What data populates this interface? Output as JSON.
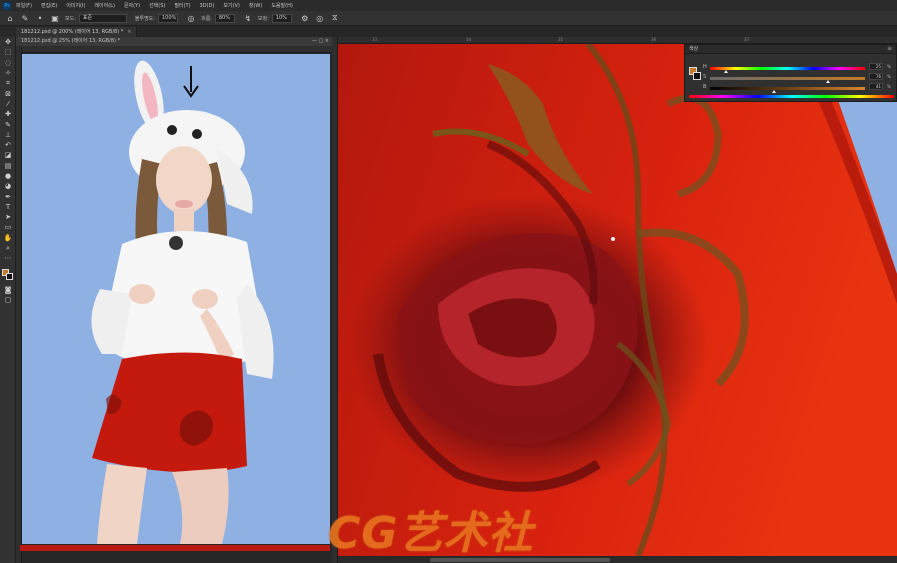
{
  "menu": {
    "app_icon": "Ps",
    "items": [
      "파일(F)",
      "편집(E)",
      "이미지(I)",
      "레이어(L)",
      "문자(Y)",
      "선택(S)",
      "필터(T)",
      "3D(D)",
      "보기(V)",
      "창(W)",
      "도움말(H)"
    ]
  },
  "options": {
    "mode_label": "모드:",
    "mode_value": "표준",
    "opacity_label": "불투명도:",
    "opacity_value": "100%",
    "flow_label": "흐름:",
    "flow_value": "80%",
    "smoothing_label": "보정:",
    "smoothing_value": "10%"
  },
  "tab": {
    "title": "181212.psd @ 200% (레이어 13, RGB/8) *",
    "close": "×"
  },
  "left_doc": {
    "title": "181212.psd @ 25% (레이어 13, RGB/8) *"
  },
  "ruler_right": [
    "33",
    "34",
    "35",
    "36",
    "37"
  ],
  "color_panel": {
    "title": "색상",
    "menu_icon": "≡",
    "channels": [
      {
        "label": "H",
        "value": "25",
        "unit": "%",
        "thumb": 0.1
      },
      {
        "label": "S",
        "value": "76",
        "unit": "%",
        "thumb": 0.76
      },
      {
        "label": "B",
        "value": "41",
        "unit": "%",
        "thumb": 0.41
      }
    ],
    "fg_color": "#c07a2a",
    "bg_color": "#111111"
  },
  "watermark": "CG艺术社",
  "colors": {
    "canvas_bg": "#8fb0e2",
    "skirt_red": "#c41a0e",
    "watermark": "#e8731f"
  },
  "tools": [
    "move-icon",
    "marquee-icon",
    "lasso-icon",
    "quick-select-icon",
    "crop-icon",
    "frame-icon",
    "eyedropper-icon",
    "healing-icon",
    "brush-icon",
    "clone-stamp-icon",
    "history-brush-icon",
    "eraser-icon",
    "gradient-icon",
    "blur-icon",
    "dodge-icon",
    "pen-icon",
    "type-icon",
    "path-select-icon",
    "rectangle-icon",
    "hand-icon",
    "zoom-icon",
    "more-icon"
  ]
}
